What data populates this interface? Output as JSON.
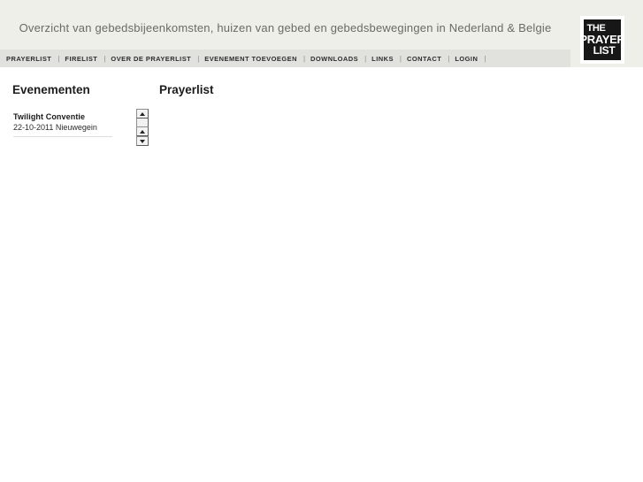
{
  "header": {
    "tagline": "Overzicht van gebedsbijeenkomsten, huizen van gebed en gebedsbewegingen in Nederland & Belgie",
    "logo": {
      "line1": "THE",
      "line2": "PRAYER",
      "line3": "LIST",
      "background_color": "#171717",
      "text_color": "#ffffff"
    },
    "background_color": "#efefea"
  },
  "nav": {
    "background_color": "#e1e2dd",
    "separator": "|",
    "items": [
      {
        "label": "PRAYERLIST"
      },
      {
        "label": "FIRELIST"
      },
      {
        "label": "OVER DE PRAYERLIST"
      },
      {
        "label": "EVENEMENT TOEVOEGEN"
      },
      {
        "label": "DOWNLOADS"
      },
      {
        "label": "LINKS"
      },
      {
        "label": "CONTACT"
      },
      {
        "label": "LOGIN"
      }
    ]
  },
  "main": {
    "columns": {
      "events_heading": "Evenementen",
      "prayerlist_heading": "Prayerlist"
    },
    "events": [
      {
        "title": "Twilight Conventie",
        "meta": "22-10-2011 Nieuwegein"
      }
    ],
    "scroll_controls": {
      "up_top": "scroll-up-icon",
      "up_bottom": "scroll-up-icon",
      "down_bottom": "scroll-down-icon"
    }
  }
}
